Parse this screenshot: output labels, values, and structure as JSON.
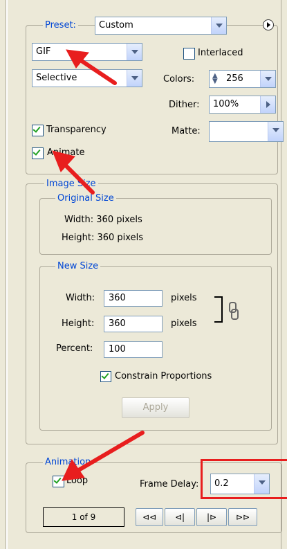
{
  "optimize": {
    "preset_label": "Preset:",
    "preset_value": "Custom",
    "format_value": "GIF",
    "reduction_value": "Selective",
    "interlaced_label": "Interlaced",
    "colors_label": "Colors:",
    "colors_value": "256",
    "dither_label": "Dither:",
    "dither_value": "100%",
    "matte_label": "Matte:",
    "transparency_label": "Transparency",
    "animate_label": "Animate"
  },
  "image_size": {
    "title": "Image Size",
    "original_title": "Original Size",
    "orig_width": "Width: 360 pixels",
    "orig_height": "Height: 360 pixels",
    "new_title": "New Size",
    "width_label": "Width:",
    "width_value": "360",
    "height_label": "Height:",
    "height_value": "360",
    "percent_label": "Percent:",
    "percent_value": "100",
    "unit_pixels": "pixels",
    "constrain_label": "Constrain Proportions",
    "apply_label": "Apply"
  },
  "animation": {
    "title": "Animation",
    "loop_label": "Loop",
    "frame_delay_label": "Frame Delay:",
    "frame_delay_value": "0.2",
    "frame_counter": "1 of 9",
    "nav": [
      "⊲⊲",
      "⊲|",
      "|⊳",
      "⊳⊳"
    ]
  },
  "colors": {
    "annotation_red": "#e81e1e",
    "label_blue": "#0046d5"
  }
}
